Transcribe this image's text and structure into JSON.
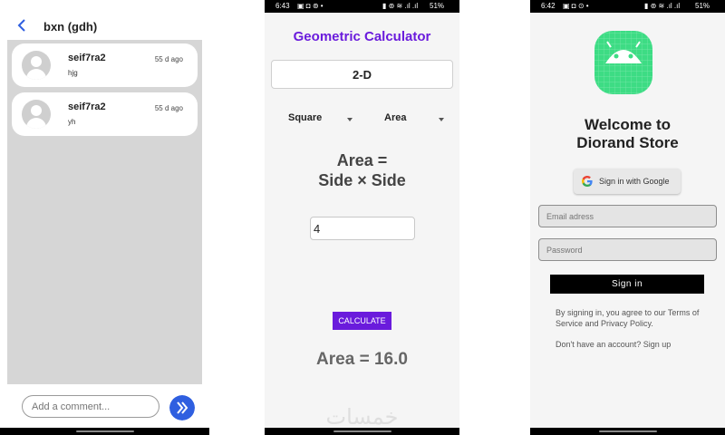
{
  "comments_screen": {
    "title": "bxn (gdh)",
    "comments": [
      {
        "name": "seif7ra2",
        "time": "55 d ago",
        "text": "hjg"
      },
      {
        "name": "seif7ra2",
        "time": "55 d ago",
        "text": "yh"
      }
    ],
    "input_placeholder": "Add a comment...",
    "accent": "#2f5fe0"
  },
  "calculator_screen": {
    "status_time": "6:43",
    "status_battery": "51%",
    "title": "Geometric Calculator",
    "dimension": "2-D",
    "shape": "Square",
    "property": "Area",
    "formula_line1": "Area =",
    "formula_line2": "Side × Side",
    "input_value": "4",
    "button_label": "CALCULATE",
    "result": "Area = 16.0",
    "watermark": "خمسات",
    "accent": "#6a1bdc"
  },
  "store_screen": {
    "status_time": "6:42",
    "status_battery": "51%",
    "welcome_line1": "Welcome to",
    "welcome_line2": "Diorand Store",
    "google_label": "Sign in with Google",
    "email_placeholder": "Email adress",
    "password_placeholder": "Password",
    "signin_label": "Sign in",
    "terms": "By signing in, you agree to our Terms of Service and Privacy Policy.",
    "signup": "Don't have an account? Sign up",
    "logo_color": "#3ddc84"
  }
}
